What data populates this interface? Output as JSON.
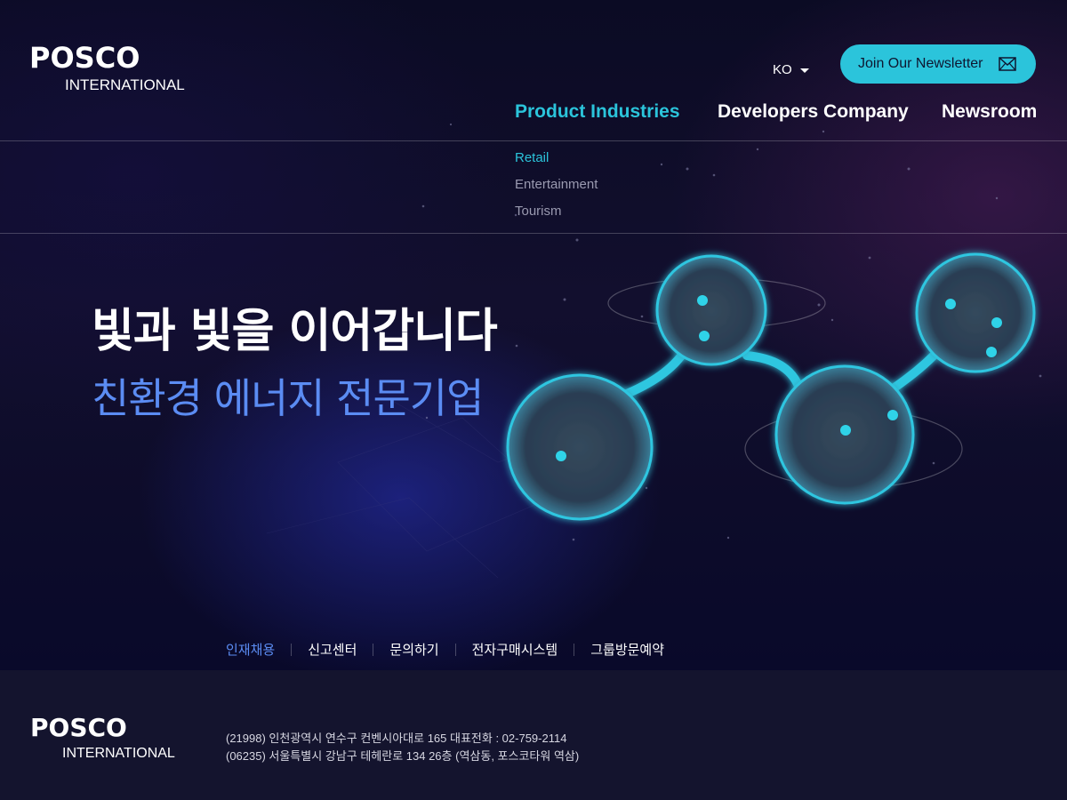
{
  "brand": {
    "name": "POSCO",
    "subname": "INTERNATIONAL"
  },
  "header": {
    "language": "KO",
    "newsletter_label": "Join Our Newsletter",
    "nav": [
      {
        "label": "Product Industries",
        "active": true
      },
      {
        "label": "Developers Company",
        "active": false
      },
      {
        "label": "Newsroom",
        "active": false
      }
    ],
    "submenu": [
      {
        "label": "Retail",
        "active": true
      },
      {
        "label": "Entertainment",
        "active": false
      },
      {
        "label": "Tourism",
        "active": false
      }
    ]
  },
  "hero": {
    "headline": "빛과 빛을 이어갑니다",
    "subheadline": "친환경 에너지 전문기업"
  },
  "footer_links": [
    "인재채용",
    "신고센터",
    "문의하기",
    "전자구매시스템",
    "그룹방문예약"
  ],
  "footer": {
    "address_1": "(21998) 인천광역시 연수구 컨벤시아대로 165 대표전화 : 02-759-2114",
    "address_2": "(06235) 서울특별시 강남구 테헤란로 134 26층 (역삼동, 포스코타워 역삼)"
  },
  "colors": {
    "accent": "#2bc4db",
    "headline_blue": "#5b8cf3",
    "background": "#0a0a22",
    "footer_bg": "#14142e"
  },
  "icons": [
    "caret-down-icon",
    "mail-icon"
  ]
}
